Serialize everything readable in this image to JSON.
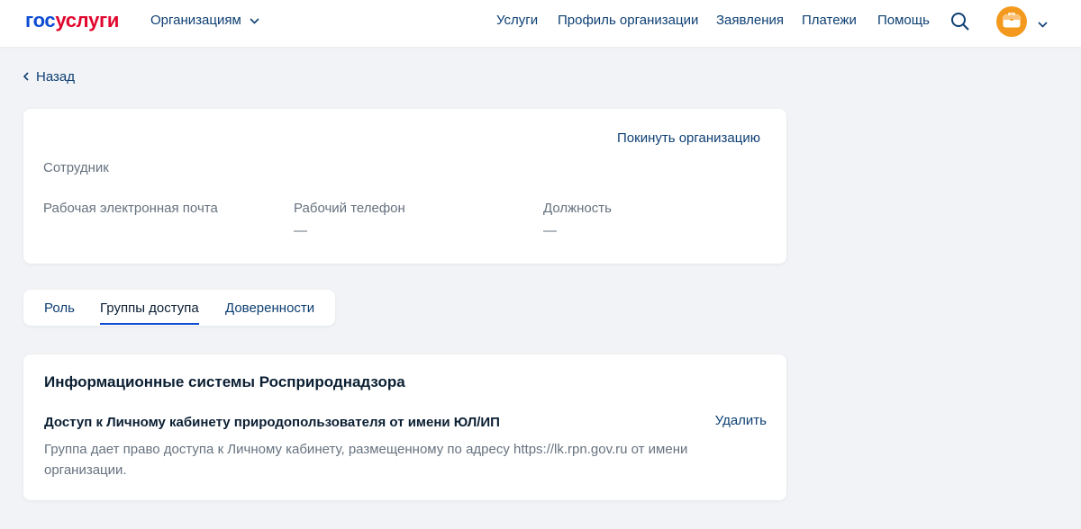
{
  "header": {
    "logo_part1": "гос",
    "logo_part2": "услуги",
    "org_menu_label": "Организациям",
    "nav": [
      "Услуги",
      "Профиль организации",
      "Заявления",
      "Платежи",
      "Помощь"
    ]
  },
  "back_label": "Назад",
  "employee_card": {
    "leave_label": "Покинуть организацию",
    "role": "Сотрудник",
    "fields": [
      {
        "label": "Рабочая электронная почта",
        "value": ""
      },
      {
        "label": "Рабочий телефон",
        "value": "—"
      },
      {
        "label": "Должность",
        "value": "—"
      }
    ]
  },
  "tabs": [
    {
      "label": "Роль",
      "active": false
    },
    {
      "label": "Группы доступа",
      "active": true
    },
    {
      "label": "Доверенности",
      "active": false
    }
  ],
  "access_card": {
    "system_title": "Информационные системы Росприроднадзора",
    "group_title": "Доступ к Личному кабинету природопользователя от имени ЮЛ/ИП",
    "delete_label": "Удалить",
    "group_description": "Группа дает право доступа к Личному кабинету, размещенному по адресу https://lk.rpn.gov.ru от имени организации."
  },
  "colors": {
    "accent": "#0d4cd3",
    "link": "#0d3f73",
    "brand_red": "#e1062d",
    "avatar": "#f39a1e",
    "background": "#f1f3f6"
  },
  "icons": [
    "chevron-down-icon",
    "search-icon",
    "briefcase-icon",
    "chevron-left-icon"
  ]
}
